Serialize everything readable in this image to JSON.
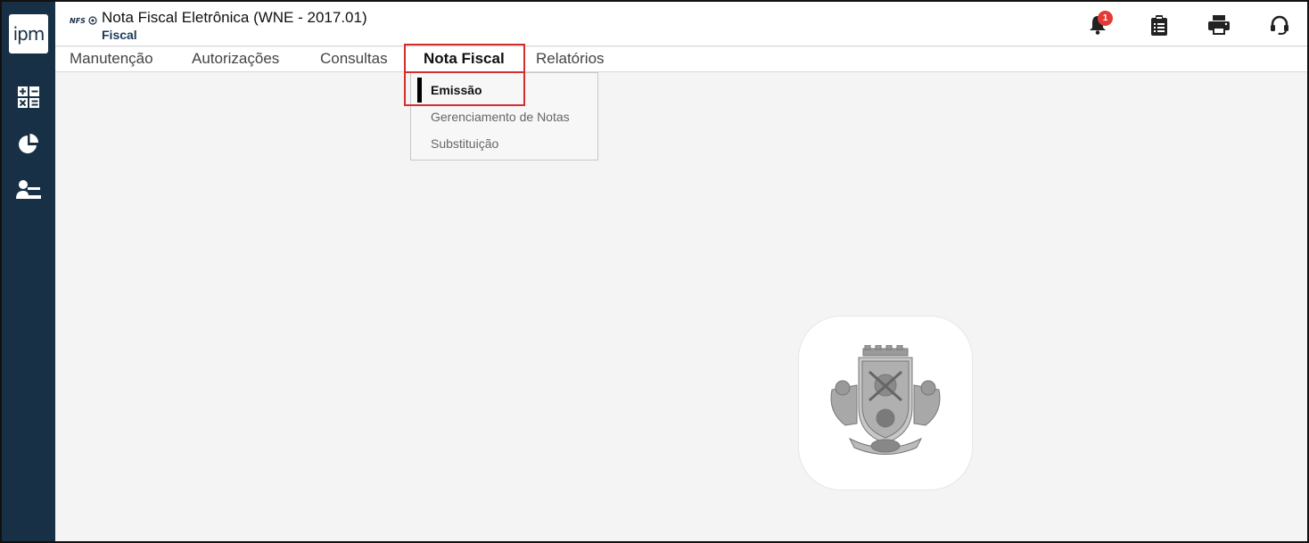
{
  "sidebar": {
    "logo_text": "ipm",
    "icons": [
      "calculator-icon",
      "pie-chart-icon",
      "user-desk-icon"
    ]
  },
  "header": {
    "nfs_badge": "NFS",
    "title": "Nota Fiscal Eletrônica (WNE - 2017.01)",
    "subtitle": "Fiscal",
    "notification_count": "1",
    "icons": [
      "bell-icon",
      "clipboard-icon",
      "printer-icon",
      "headset-icon"
    ]
  },
  "menu": {
    "items": [
      {
        "label": "Manutenção"
      },
      {
        "label": "Autorizações"
      },
      {
        "label": "Consultas"
      },
      {
        "label": "Nota Fiscal",
        "active": true
      },
      {
        "label": "Relatórios"
      }
    ]
  },
  "dropdown": {
    "items": [
      {
        "label": "Emissão",
        "selected": true
      },
      {
        "label": "Gerenciamento de Notas"
      },
      {
        "label": "Substituição"
      }
    ]
  },
  "colors": {
    "sidebar": "#173046",
    "highlight": "#d32f2f",
    "badge": "#e53935"
  }
}
